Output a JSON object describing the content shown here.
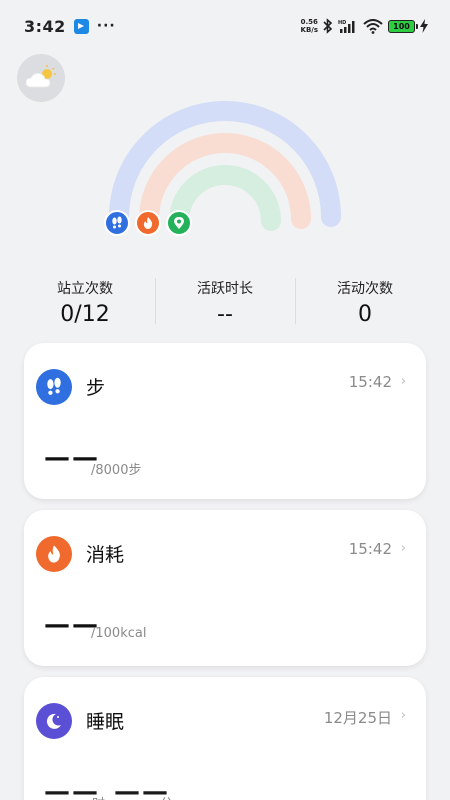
{
  "status_bar": {
    "time": "3:42",
    "more": "···",
    "net_speed_value": "0.56",
    "net_speed_unit": "KB/s",
    "battery": "100"
  },
  "rings": {
    "steps_color": "#2f6fe0",
    "calories_color": "#ef6a2c",
    "activity_color": "#23b25a"
  },
  "stats": [
    {
      "label": "站立次数",
      "value": "0/12"
    },
    {
      "label": "活跃时长",
      "value": "--"
    },
    {
      "label": "活动次数",
      "value": "0"
    }
  ],
  "cards": {
    "steps": {
      "title": "步",
      "time": "15:42",
      "value": "——",
      "unit": "/8000步",
      "icon": "footprints-icon"
    },
    "calories": {
      "title": "消耗",
      "time": "15:42",
      "value": "——",
      "unit": "/100kcal",
      "icon": "flame-icon"
    },
    "sleep": {
      "title": "睡眠",
      "date": "12月25日",
      "hours_value": "——",
      "hours_unit": "时",
      "minutes_value": "——",
      "minutes_unit": "分",
      "icon": "moon-icon"
    }
  }
}
